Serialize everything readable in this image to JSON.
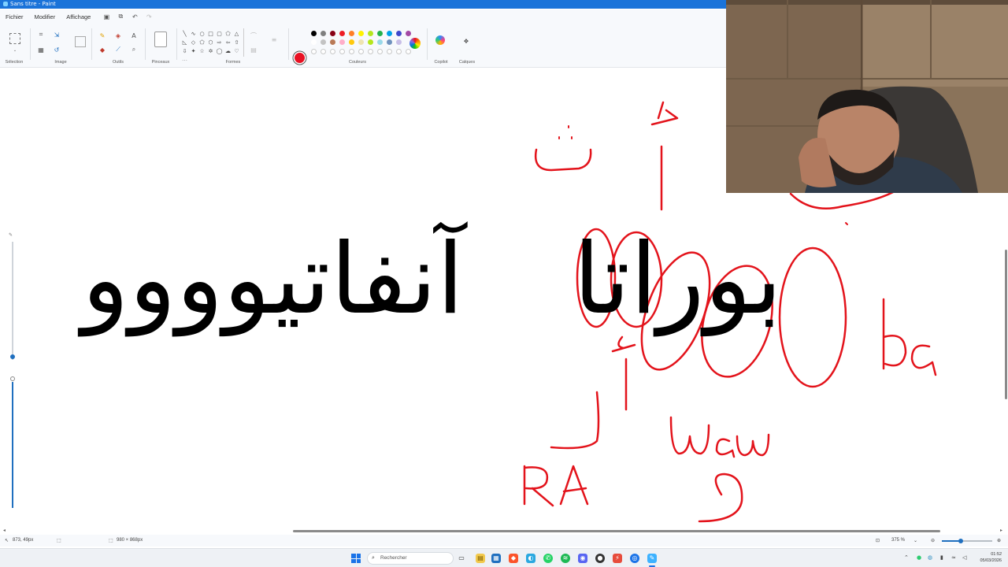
{
  "window": {
    "title": "Sans titre - Paint"
  },
  "menu": {
    "items": [
      "Fichier",
      "Modifier",
      "Affichage"
    ]
  },
  "ribbon": {
    "groups": {
      "selection": "Sélection",
      "image": "Image",
      "tools": "Outils",
      "brushes": "Pinceaux",
      "shapes": "Formes",
      "colors": "Couleurs",
      "copilot": "Copilot",
      "layers": "Calques"
    },
    "primary_color": "#e81123",
    "palette_row1": [
      "#000000",
      "#7f7f7f",
      "#880015",
      "#ed1c24",
      "#ff7f27",
      "#fff200",
      "#b5e61d",
      "#22b14c",
      "#00a2e8",
      "#3f48cc",
      "#a349a4"
    ],
    "palette_row2": [
      "#ffffff",
      "#c3c3c3",
      "#b97a57",
      "#ffaec9",
      "#ffc90e",
      "#efe4b0",
      "#b5e61d",
      "#99d9ea",
      "#7092be",
      "#c8bfe7"
    ]
  },
  "canvas": {
    "arabic_main": "بوراتا آنفاتيوووو",
    "arabic_left": "آنفاتيوووو",
    "arabic_right": "بوراتا",
    "annotations": {
      "ba": "ba",
      "waw": "waw",
      "ra": "RA",
      "alif_hamza": "أ",
      "tha": "ث",
      "ra_letter": "ر",
      "waw_letter": "و"
    },
    "ink_color": "#e3131b"
  },
  "status": {
    "cursor_position": "873, 49px",
    "canvas_size": "980 × 868px",
    "zoom": "375 %"
  },
  "taskbar": {
    "search_placeholder": "Rechercher",
    "time": "01:52",
    "date": "05/03/2026"
  }
}
